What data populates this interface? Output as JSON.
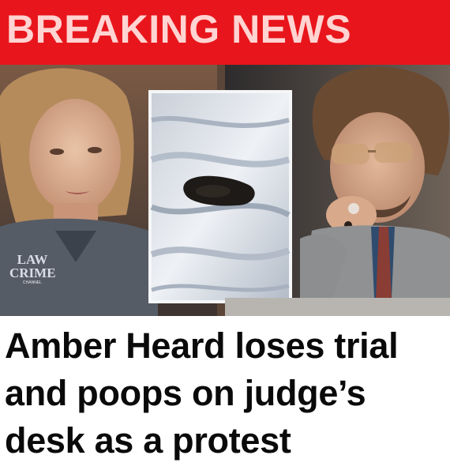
{
  "banner": {
    "text": "BREAKING NEWS",
    "color": "#e8161c"
  },
  "logo": {
    "line1": "LAW",
    "line2": "CRIME",
    "line3": "CHANNEL"
  },
  "headline": {
    "lines": [
      "Amber Heard loses trial",
      "and poops on judge’s",
      "desk as a protest"
    ]
  }
}
